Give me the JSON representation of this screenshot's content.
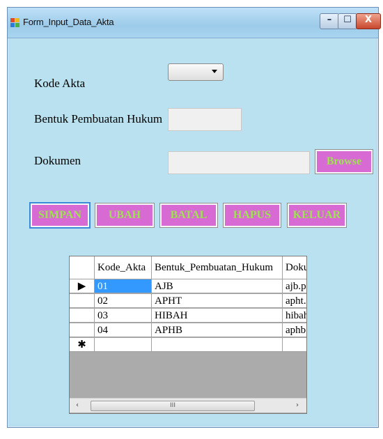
{
  "window": {
    "title": "Form_Input_Data_Akta"
  },
  "form": {
    "kode_akta_label": "Kode Akta",
    "kode_akta_value": "",
    "bentuk_label": "Bentuk Pembuatan Hukum",
    "bentuk_value": "",
    "dokumen_label": "Dokumen",
    "dokumen_value": "",
    "browse_label": "Browse"
  },
  "actions": {
    "simpan": "SIMPAN",
    "ubah": "UBAH",
    "batal": "BATAL",
    "hapus": "HAPUS",
    "keluar": "KELUAR"
  },
  "grid": {
    "columns": [
      "Kode_Akta",
      "Bentuk_Pembuatan_Hukum",
      "Doku"
    ],
    "rows": [
      [
        "01",
        "AJB",
        "ajb.pd"
      ],
      [
        "02",
        "APHT",
        "apht.p"
      ],
      [
        "03",
        "HIBAH",
        "hibah.:"
      ],
      [
        "04",
        "APHB",
        "aphb.p"
      ]
    ],
    "current_row_marker": "▶",
    "new_row_marker": "✱",
    "scroll_left": "‹",
    "scroll_right": "›",
    "scroll_grip": "III"
  },
  "colors": {
    "button_bg": "#d86bd3",
    "button_text": "#9de34f",
    "selected_cell": "#3399ff"
  }
}
